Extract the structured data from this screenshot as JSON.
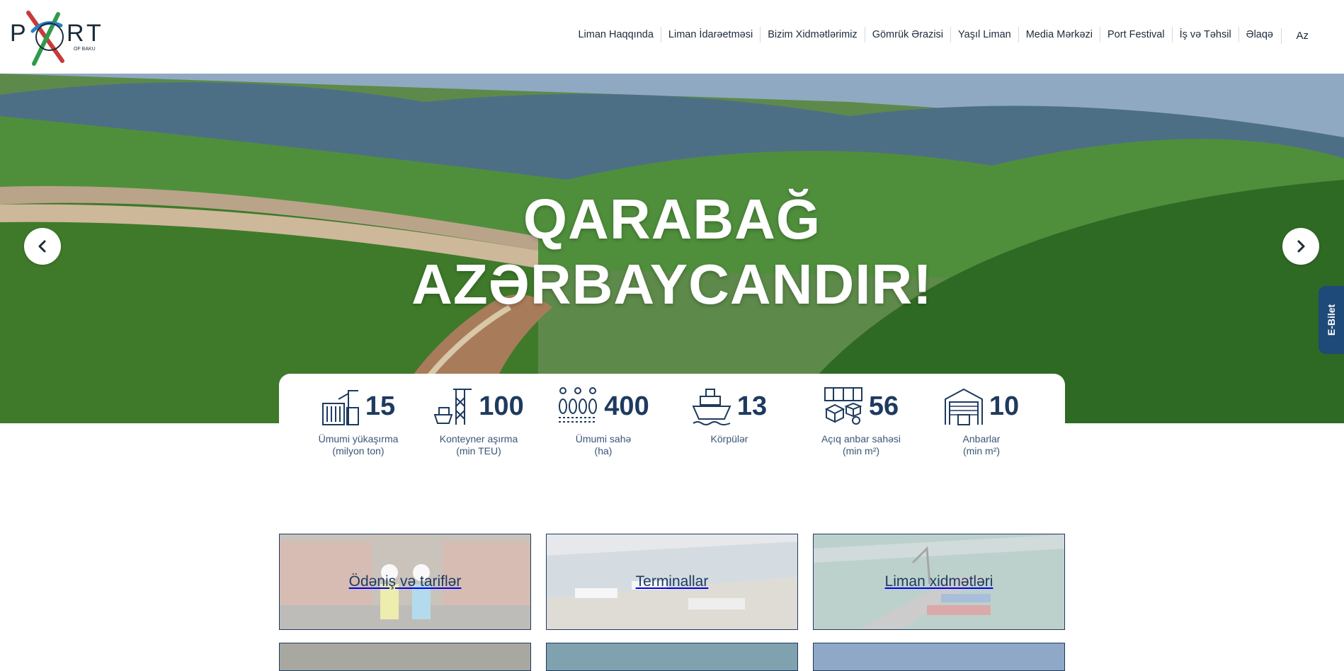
{
  "header": {
    "logo_text": "PORT",
    "logo_sub": "OF BAKU",
    "nav": [
      "Liman Haqqında",
      "Liman İdarəetməsi",
      "Bizim Xidmətlərimiz",
      "Gömrük Ərazisi",
      "Yaşıl Liman",
      "Media Mərkəzi",
      "Port Festival",
      "İş və Təhsil",
      "Əlaqə"
    ],
    "lang": "Az"
  },
  "hero": {
    "title_line1": "QARABAĞ",
    "title_line2": "AZƏRBAYCANDIR!",
    "ebilet": "E-Bilet"
  },
  "stats": [
    {
      "icon": "crane-container-icon",
      "value": "15",
      "label1": "Ümumi yükaşırma",
      "label2": "(milyon ton)"
    },
    {
      "icon": "container-crane-ship-icon",
      "value": "100",
      "label1": "Konteyner aşırma",
      "label2": "(min TEU)"
    },
    {
      "icon": "area-tanks-icon",
      "value": "400",
      "label1": "Ümumi sahə",
      "label2": "(ha)"
    },
    {
      "icon": "ship-icon",
      "value": "13",
      "label1": "Körpülər",
      "label2": ""
    },
    {
      "icon": "open-storage-icon",
      "value": "56",
      "label1": "Açıq anbar sahəsi",
      "label2": "(min m²)"
    },
    {
      "icon": "warehouse-icon",
      "value": "10",
      "label1": "Anbarlar",
      "label2": "(min m²)"
    }
  ],
  "tiles": [
    {
      "label": "Ödəniş və tariflər"
    },
    {
      "label": "Terminallar"
    },
    {
      "label": "Liman xidmətləri"
    }
  ],
  "colors": {
    "primary": "#1e3a5f",
    "ebilet": "#1e4a7a"
  }
}
